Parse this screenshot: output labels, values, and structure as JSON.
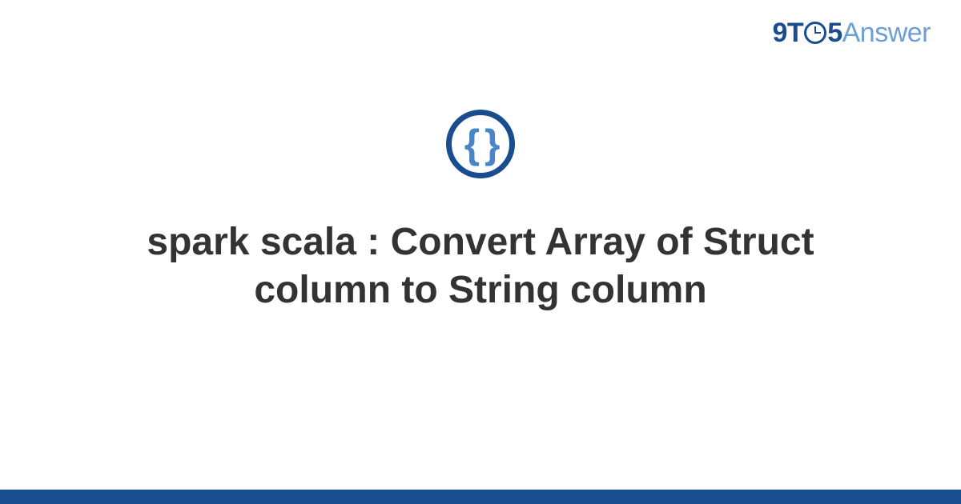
{
  "logo": {
    "part1": "9T",
    "part2": "5",
    "part3": "Answer"
  },
  "icon": {
    "braces": "{ }"
  },
  "title": "spark scala : Convert Array of Struct column to String column",
  "colors": {
    "primary": "#1a4d8f",
    "secondary": "#4a86c7",
    "logo_light": "#6b9fd8",
    "text": "#333333"
  }
}
